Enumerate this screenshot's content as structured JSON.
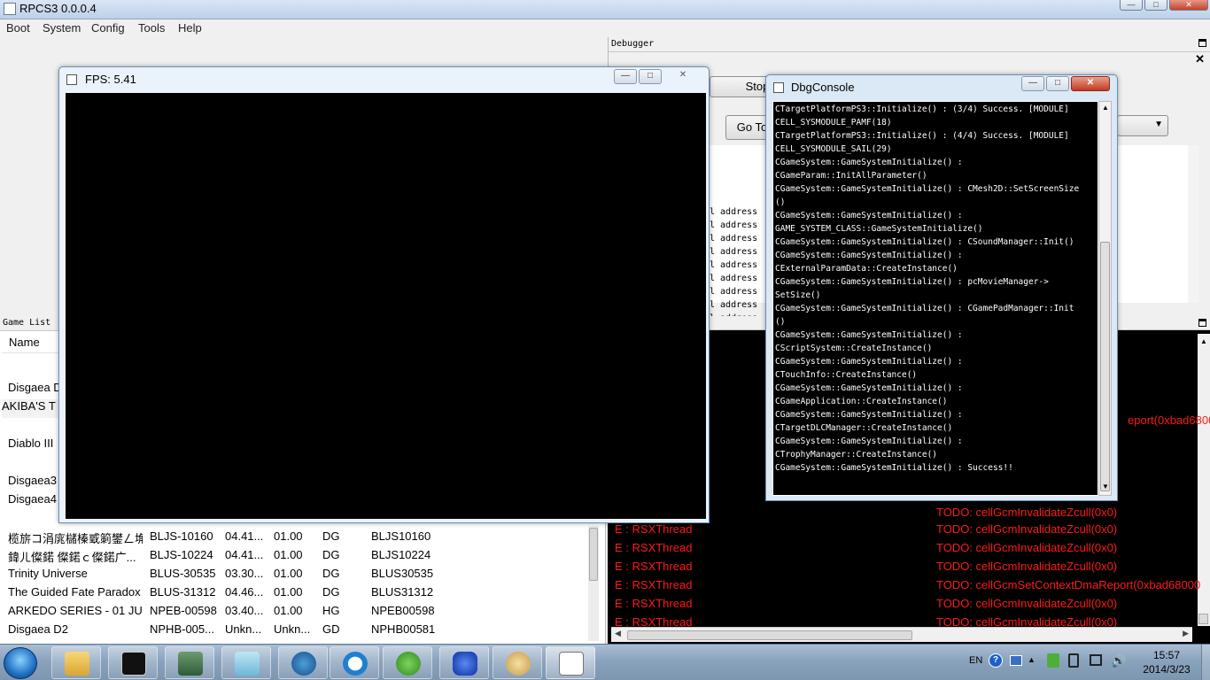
{
  "main_window": {
    "title": "RPCS3 0.0.0.4",
    "menu": [
      "Boot",
      "System",
      "Config",
      "Tools",
      "Help"
    ]
  },
  "debugger": {
    "title": "Debugger",
    "stop_label": "Stop",
    "goto_label": "Go To",
    "address_label": "l address",
    "rows": 10
  },
  "game_list": {
    "title": "Game List",
    "column_name": "Name",
    "rows": [
      {
        "name": "Disgaea D",
        "serial": "",
        "date": "",
        "ver": "",
        "cat": "",
        "path": ""
      },
      {
        "name": "AKIBA'S T",
        "serial": "",
        "date": "",
        "ver": "",
        "cat": "",
        "path": ""
      },
      {
        "name": "Diablo III",
        "serial": "",
        "date": "",
        "ver": "",
        "cat": "",
        "path": ""
      },
      {
        "name": "Disgaea3",
        "serial": "",
        "date": "",
        "ver": "",
        "cat": "",
        "path": ""
      },
      {
        "name": "Disgaea4",
        "serial": "",
        "date": "",
        "ver": "",
        "cat": "",
        "path": ""
      },
      {
        "name": "榄旂コ涓庣櫧榛戜箣鐢ㄥ埆",
        "serial": "BLJS-10160",
        "date": "04.41...",
        "ver": "01.00",
        "cat": "DG",
        "path": "BLJS10160"
      },
      {
        "name": "鍏ㄦ儏鍩   儏鍩ｃ儏鍩广...",
        "serial": "BLJS-10224",
        "date": "04.41...",
        "ver": "01.00",
        "cat": "DG",
        "path": "BLJS10224"
      },
      {
        "name": "Trinity Universe",
        "serial": "BLUS-30535",
        "date": "03.30...",
        "ver": "01.00",
        "cat": "DG",
        "path": "BLUS30535"
      },
      {
        "name": "The Guided Fate Paradox",
        "serial": "BLUS-31312",
        "date": "04.46...",
        "ver": "01.00",
        "cat": "DG",
        "path": "BLUS31312"
      },
      {
        "name": "ARKEDO SERIES - 01 JU...",
        "serial": "NPEB-00598",
        "date": "03.40...",
        "ver": "01.00",
        "cat": "HG",
        "path": "NPEB00598"
      },
      {
        "name": "Disgaea D2",
        "serial": "NPHB-005...",
        "date": "Unkn...",
        "ver": "Unkn...",
        "cat": "GD",
        "path": "NPHB00581"
      }
    ]
  },
  "log": {
    "partial_top": "eport(0xbad68000",
    "rows": [
      {
        "thread": "E : RSXThread",
        "msg": "TODO: cellGcmInvalidateZcull(0x0)"
      },
      {
        "thread": "E : RSXThread",
        "msg": "TODO: cellGcmInvalidateZcull(0x0)"
      },
      {
        "thread": "E : RSXThread",
        "msg": "TODO: cellGcmInvalidateZcull(0x0)"
      },
      {
        "thread": "E : RSXThread",
        "msg": "TODO: cellGcmSetContextDmaReport(0xbad68000"
      },
      {
        "thread": "E : RSXThread",
        "msg": "TODO: cellGcmInvalidateZcull(0x0)"
      },
      {
        "thread": "E : RSXThread",
        "msg": "TODO: cellGcmInvalidateZcull(0x0)"
      }
    ],
    "top_partial": "TODO: cellGcmInvalidateZcull(0x0)"
  },
  "fps_window": {
    "title": "FPS: 5.41"
  },
  "dbg_console": {
    "title": "DbgConsole",
    "lines": [
      "CTargetPlatformPS3::Initialize() : (3/4) Success. [MODULE]",
      "CELL_SYSMODULE_PAMF(18)",
      "CTargetPlatformPS3::Initialize() : (4/4) Success. [MODULE]",
      "CELL_SYSMODULE_SAIL(29)",
      "CGameSystem::GameSystemInitialize() :",
      "CGameParam::InitAllParameter()",
      "CGameSystem::GameSystemInitialize() : CMesh2D::SetScreenSize",
      "()",
      "CGameSystem::GameSystemInitialize() :",
      "GAME_SYSTEM_CLASS::GameSystemInitialize()",
      "CGameSystem::GameSystemInitialize() : CSoundManager::Init()",
      "CGameSystem::GameSystemInitialize() :",
      "CExternalParamData::CreateInstance()",
      "CGameSystem::GameSystemInitialize() : pcMovieManager->",
      "SetSize()",
      "CGameSystem::GameSystemInitialize() : CGamePadManager::Init",
      "()",
      "CGameSystem::GameSystemInitialize() :",
      "CScriptSystem::CreateInstance()",
      "CGameSystem::GameSystemInitialize() :",
      "CTouchInfo::CreateInstance()",
      "CGameSystem::GameSystemInitialize() :",
      "CGameApplication::CreateInstance()",
      "CGameSystem::GameSystemInitialize() :",
      "CTargetDLCManager::CreateInstance()",
      "CGameSystem::GameSystemInitialize() :",
      "CTrophyManager::CreateInstance()",
      "CGameSystem::GameSystemInitialize() : Success!!"
    ]
  },
  "taskbar": {
    "lang": "EN",
    "time": "15:57",
    "date": "2014/3/23",
    "apps": [
      "explorer",
      "cmd",
      "rpcs3",
      "notepad",
      "cheat-engine",
      "sogou",
      "utorrent",
      "blue-app",
      "paint",
      "viewer"
    ]
  },
  "colors": {
    "log_red": "#ff1a1a",
    "console_bg": "#000000"
  }
}
